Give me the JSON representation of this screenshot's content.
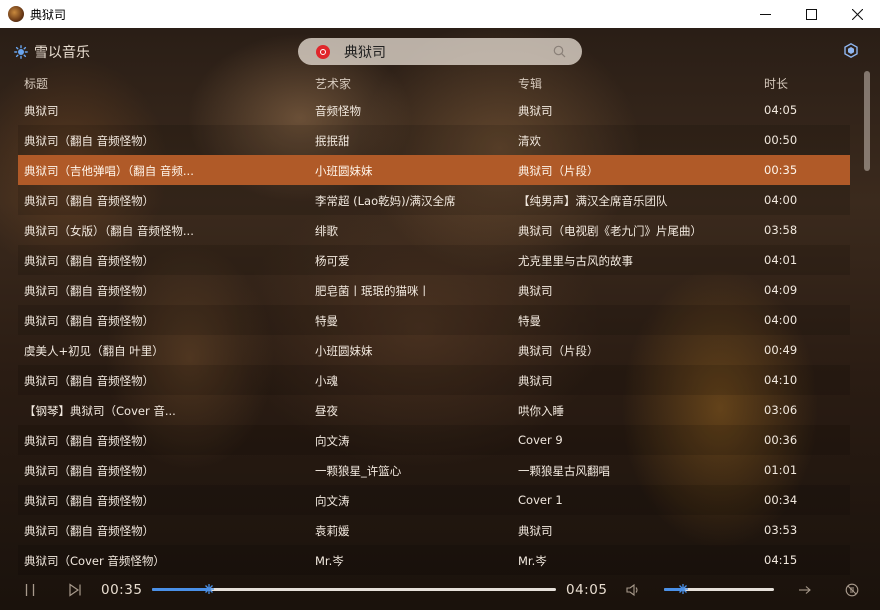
{
  "window": {
    "title": "典狱司"
  },
  "app": {
    "name": "雪以音乐"
  },
  "search": {
    "query": "典狱司"
  },
  "columns": {
    "title": "标题",
    "artist": "艺术家",
    "album": "专辑",
    "duration": "时长"
  },
  "tracks": [
    {
      "title": "典狱司",
      "artist": "音频怪物",
      "album": "典狱司",
      "duration": "04:05"
    },
    {
      "title": "典狱司（翻自 音频怪物）",
      "artist": "抿抿甜",
      "album": "清欢",
      "duration": "00:50"
    },
    {
      "title": "典狱司（吉他弹唱）（翻自 音频...",
      "artist": "小班圆妹妹",
      "album": "典狱司（片段）",
      "duration": "00:35"
    },
    {
      "title": "典狱司（翻自 音频怪物）",
      "artist": "李常超 (Lao乾妈)/满汉全席",
      "album": "【纯男声】满汉全席音乐团队",
      "duration": "04:00"
    },
    {
      "title": "典狱司（女版）（翻自 音频怪物...",
      "artist": "绯歌",
      "album": "典狱司（电视剧《老九门》片尾曲）",
      "duration": "03:58"
    },
    {
      "title": "典狱司（翻自 音频怪物）",
      "artist": "杨可爱",
      "album": "尤克里里与古风的故事",
      "duration": "04:01"
    },
    {
      "title": "典狱司（翻自 音频怪物）",
      "artist": "肥皂菌丨珉珉的猫咪丨",
      "album": "典狱司",
      "duration": "04:09"
    },
    {
      "title": "典狱司（翻自 音频怪物）",
      "artist": "特曼",
      "album": "特曼",
      "duration": "04:00"
    },
    {
      "title": "虞美人+初见（翻自 叶里）",
      "artist": "小班圆妹妹",
      "album": "典狱司（片段）",
      "duration": "00:49"
    },
    {
      "title": "典狱司（翻自 音频怪物）",
      "artist": "小魂",
      "album": "典狱司",
      "duration": "04:10"
    },
    {
      "title": "【钢琴】典狱司（Cover 音...",
      "artist": "昼夜",
      "album": "哄你入睡",
      "duration": "03:06"
    },
    {
      "title": "典狱司（翻自 音频怪物）",
      "artist": "向文涛",
      "album": "Cover 9",
      "duration": "00:36"
    },
    {
      "title": "典狱司（翻自 音频怪物）",
      "artist": "一颗狼星_许篮心",
      "album": "一颗狼星古风翻唱",
      "duration": "01:01"
    },
    {
      "title": "典狱司（翻自 音频怪物）",
      "artist": "向文涛",
      "album": "Cover 1",
      "duration": "00:34"
    },
    {
      "title": "典狱司（翻自 音频怪物）",
      "artist": "袁莉媛",
      "album": "典狱司",
      "duration": "03:53"
    },
    {
      "title": "典狱司（Cover 音频怪物）",
      "artist": "Mr.岑",
      "album": "Mr.岑",
      "duration": "04:15"
    }
  ],
  "active_track_index": 2,
  "player": {
    "current_time": "00:35",
    "total_time": "04:05",
    "progress_fraction": 0.14,
    "volume_fraction": 0.17
  },
  "colors": {
    "accent_row": "#b05a28",
    "progress": "#4a90e8",
    "search_badge": "#e0262b"
  },
  "icons": [
    "app-icon",
    "logo-icon",
    "search-icon",
    "skin-icon",
    "pause-icon",
    "next-icon",
    "volume-icon",
    "mode-icon",
    "lyrics-icon"
  ]
}
